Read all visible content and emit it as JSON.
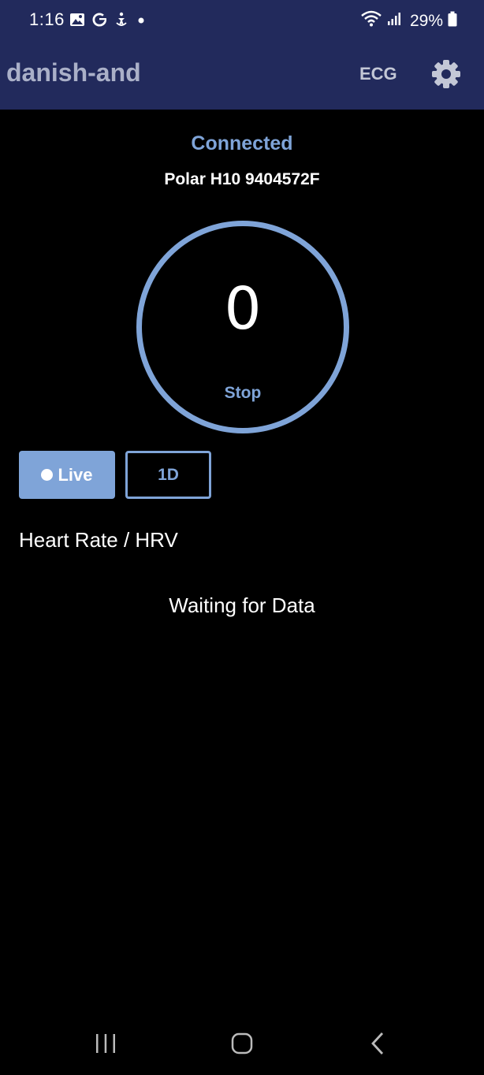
{
  "status_bar": {
    "time": "1:16",
    "battery": "29%",
    "left_icons": [
      "gallery-icon",
      "google-icon",
      "accessibility-icon",
      "dot-icon"
    ],
    "right_icons": [
      "wifi-icon",
      "signal-icon",
      "battery-icon"
    ]
  },
  "app_bar": {
    "title": "danish-and",
    "ecg_label": "ECG",
    "settings_icon": "gear-icon"
  },
  "main": {
    "connection_status": "Connected",
    "device_name": "Polar H10 9404572F",
    "heart_rate_value": "0",
    "stop_label": "Stop",
    "live_label": "Live",
    "range_label": "1D",
    "section_heading": "Heart Rate / HRV",
    "waiting_text": "Waiting for Data"
  },
  "nav_bar": {
    "icons": [
      "recent-apps-icon",
      "home-icon",
      "back-icon"
    ]
  },
  "colors": {
    "app_bar": "#222a5c",
    "accent": "#7fa4d8",
    "background": "#000000"
  }
}
